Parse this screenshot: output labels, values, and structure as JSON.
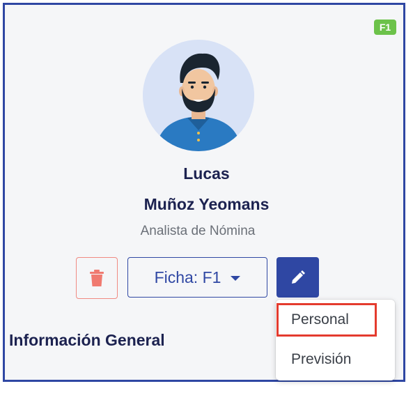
{
  "badge": "F1",
  "profile": {
    "first_name": "Lucas",
    "last_name": "Muñoz Yeomans",
    "job_title": "Analista de Nómina"
  },
  "actions": {
    "ficha_label": "Ficha: F1"
  },
  "section": {
    "title": "Información General"
  },
  "dropdown": {
    "items": [
      "Personal",
      "Previsión"
    ],
    "highlighted": "Personal"
  },
  "colors": {
    "accent": "#2f47a3",
    "danger": "#f08a82",
    "badge": "#6cc24a",
    "highlight_border": "#e43b2e"
  }
}
